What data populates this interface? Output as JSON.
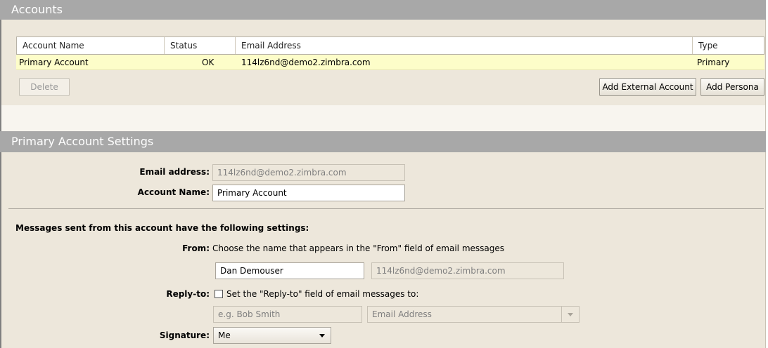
{
  "accounts_section": {
    "title": "Accounts",
    "columns": [
      "Account Name",
      "Status",
      "Email Address",
      "Type"
    ],
    "rows": [
      {
        "name": "Primary Account",
        "status": "OK",
        "email": "114lz6nd@demo2.zimbra.com",
        "type": "Primary"
      }
    ],
    "delete_label": "Delete",
    "add_external_label": "Add External Account",
    "add_persona_label": "Add Persona"
  },
  "settings_section": {
    "title": "Primary Account Settings",
    "email_label": "Email address:",
    "email_value": "114lz6nd@demo2.zimbra.com",
    "account_name_label": "Account Name:",
    "account_name_value": "Primary Account",
    "messages_heading": "Messages sent from this account have the following settings:",
    "from_label": "From:",
    "from_hint": "Choose the name that appears in the \"From\" field of email messages",
    "from_name_value": "Dan Demouser",
    "from_email_value": "114lz6nd@demo2.zimbra.com",
    "reply_to_label": "Reply-to:",
    "reply_to_checkbox_label": "Set the \"Reply-to\" field of email messages to:",
    "reply_to_name_placeholder": "e.g. Bob Smith",
    "reply_to_email_placeholder": "Email Address",
    "signature_label": "Signature:",
    "signature_value": "Me"
  },
  "colors": {
    "header_bg": "#a8a8a8",
    "panel_bg": "#ede7db",
    "selected_row_bg": "#fdfdc9"
  },
  "icons": [
    "dropdown-caret-icon",
    "checkbox-icon"
  ]
}
